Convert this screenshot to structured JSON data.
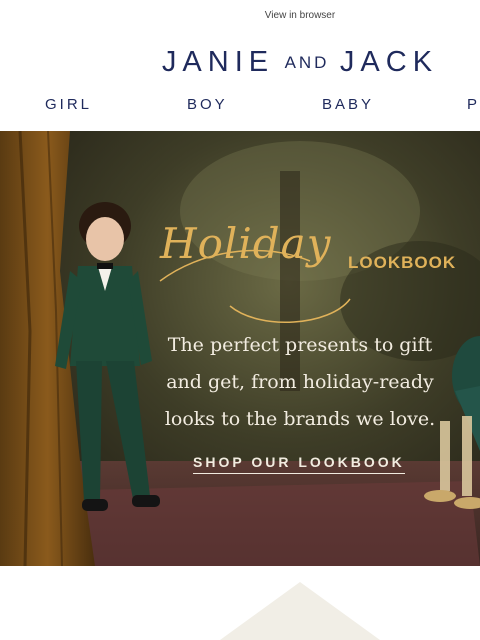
{
  "header": {
    "view_in_browser": "View in browser",
    "logo_left": "JANIE",
    "logo_mid": "AND",
    "logo_right": "JACK"
  },
  "nav": {
    "items": [
      "GIRL",
      "BOY",
      "BABY",
      "P"
    ]
  },
  "hero": {
    "script_title": "Holiday",
    "label": "LOOKBOOK",
    "tagline_lines": [
      "The perfect presents to gift",
      "and get, from holiday-ready",
      "looks to the brands we love."
    ],
    "cta": "SHOP OUR LOOKBOOK"
  },
  "colors": {
    "brand_navy": "#1f2a5c",
    "gold_accent": "#e0b25a",
    "cream_text": "#f2ece0"
  }
}
